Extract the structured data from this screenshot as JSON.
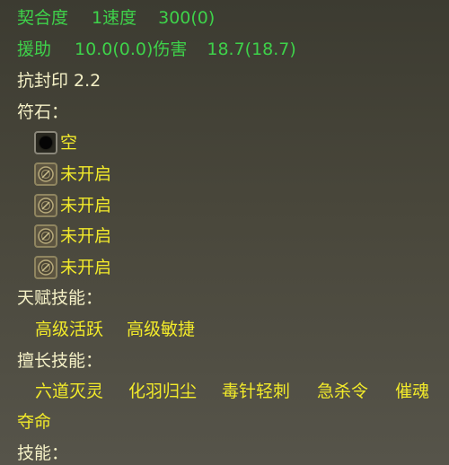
{
  "stats": {
    "affinity_label": "契合度",
    "speed_label": "1速度",
    "speed_value": "300(0)",
    "assist_label": "援助",
    "assist_value": "10.0(0.0)伤害",
    "damage_value": "18.7(18.7)",
    "seal_resist": "抗封印 2.2"
  },
  "runestones": {
    "heading": "符石：",
    "slots": [
      {
        "label": "空",
        "icon": "empty-socket-icon"
      },
      {
        "label": "未开启",
        "icon": "locked-socket-icon"
      },
      {
        "label": "未开启",
        "icon": "locked-socket-icon"
      },
      {
        "label": "未开启",
        "icon": "locked-socket-icon"
      },
      {
        "label": "未开启",
        "icon": "locked-socket-icon"
      }
    ]
  },
  "talent_skills": {
    "heading": "天赋技能：",
    "items": [
      "高级活跃",
      "高级敏捷"
    ]
  },
  "specialty_skills": {
    "heading": "擅长技能：",
    "items": [
      "六道灭灵",
      "化羽归尘",
      "毒针轻刺",
      "急杀令",
      "催魂"
    ],
    "wrap": "夺命"
  },
  "skills": {
    "heading": "技能："
  },
  "colors": {
    "stat_green": "#3ed24a",
    "heading_cream": "#f4f0c6",
    "value_yellow": "#f2ea2a"
  }
}
